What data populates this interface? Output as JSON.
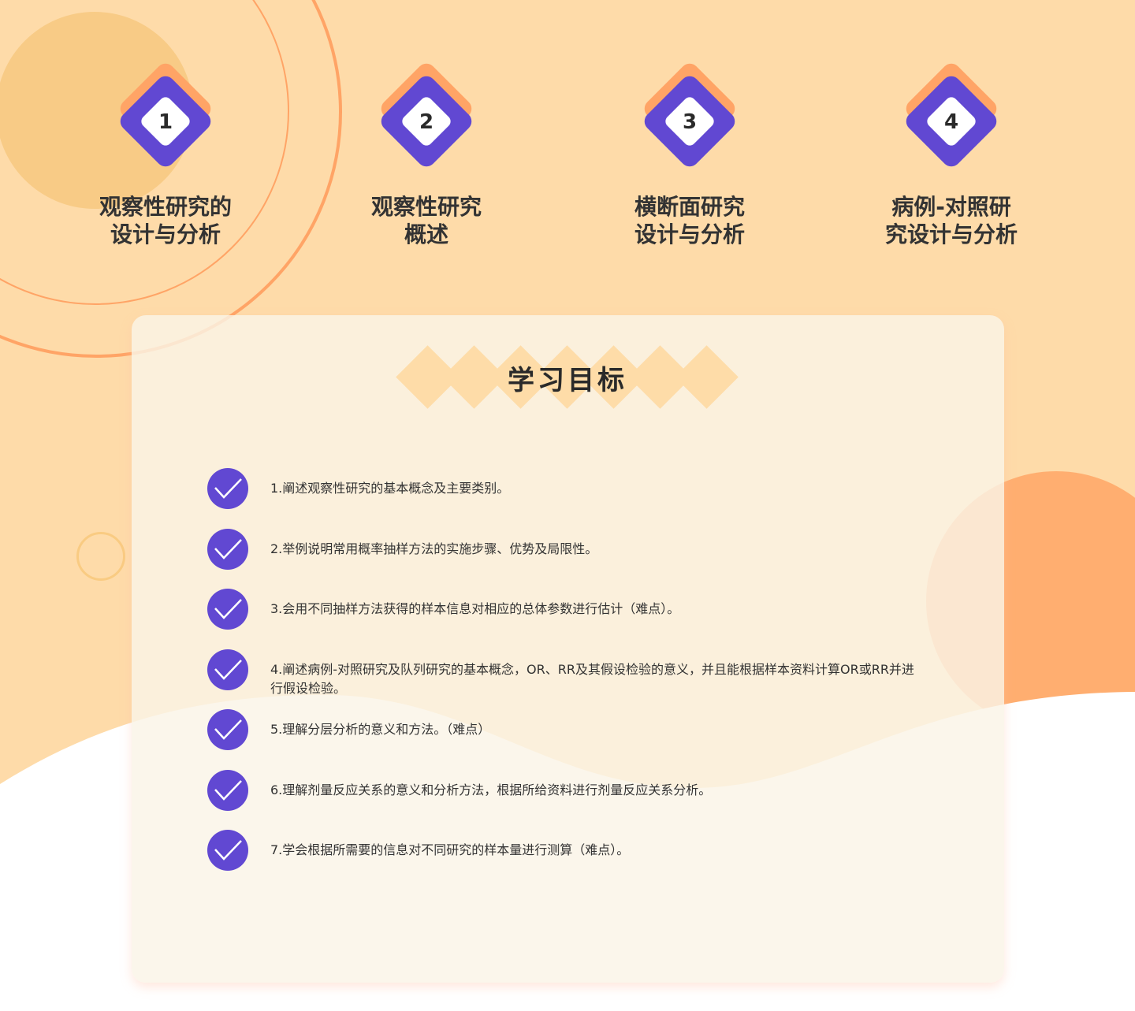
{
  "steps": [
    {
      "num": "1",
      "line1": "观察性研究的",
      "line2": "设计与分析"
    },
    {
      "num": "2",
      "line1": "观察性研究",
      "line2": "概述"
    },
    {
      "num": "3",
      "line1": "横断面研究",
      "line2": "设计与分析"
    },
    {
      "num": "4",
      "line1": "病例-对照研",
      "line2": "究设计与分析"
    }
  ],
  "objectives": {
    "title": "学习目标",
    "items": [
      "1.阐述观察性研究的基本概念及主要类别。",
      "2.举例说明常用概率抽样方法的实施步骤、优势及局限性。",
      "3.会用不同抽样方法获得的样本信息对相应的总体参数进行估计（难点）。",
      "4.阐述病例-对照研究及队列研究的基本概念，OR、RR及其假设检验的意义，并且能根据样本资料计算OR或RR并进行假设检验。",
      "5.理解分层分析的意义和方法。（难点）",
      "6.理解剂量反应关系的意义和分析方法，根据所给资料进行剂量反应关系分析。",
      "7.学会根据所需要的信息对不同研究的样本量进行测算（难点）。"
    ]
  },
  "colors": {
    "purple": "#6148D2",
    "orange": "#FFA466",
    "bg": "#FEDBA9"
  }
}
